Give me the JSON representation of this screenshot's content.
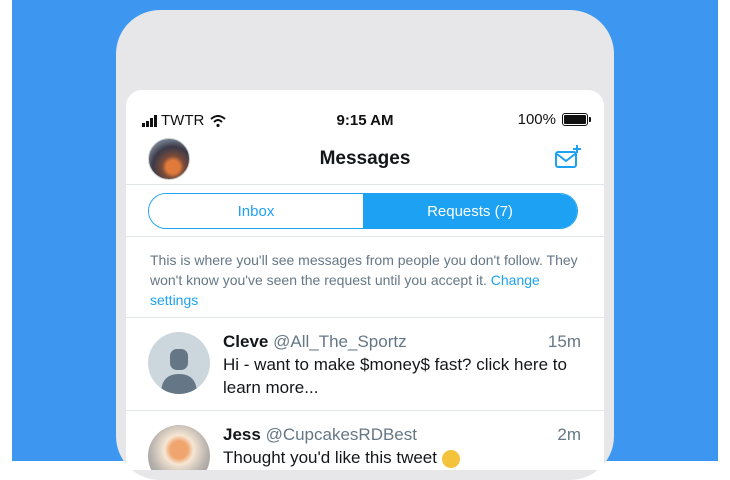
{
  "status_bar": {
    "carrier": "TWTR",
    "time": "9:15 AM",
    "battery": "100%"
  },
  "header": {
    "title": "Messages"
  },
  "tabs": {
    "inbox": "Inbox",
    "requests": "Requests (7)"
  },
  "info": {
    "text": "This is where you'll see messages from people you don't follow. They won't know you've seen the request until you accept it.",
    "link": "Change settings"
  },
  "messages": [
    {
      "name": "Cleve",
      "handle": "@All_The_Sportz",
      "time": "15m",
      "text": "Hi - want to make $money$ fast? click here to learn more..."
    },
    {
      "name": "Jess",
      "handle": "@CupcakesRDBest",
      "time": "2m",
      "text": "Thought you'd like this tweet"
    }
  ],
  "colors": {
    "background": "#3d97f0",
    "accent": "#1da1f2"
  }
}
